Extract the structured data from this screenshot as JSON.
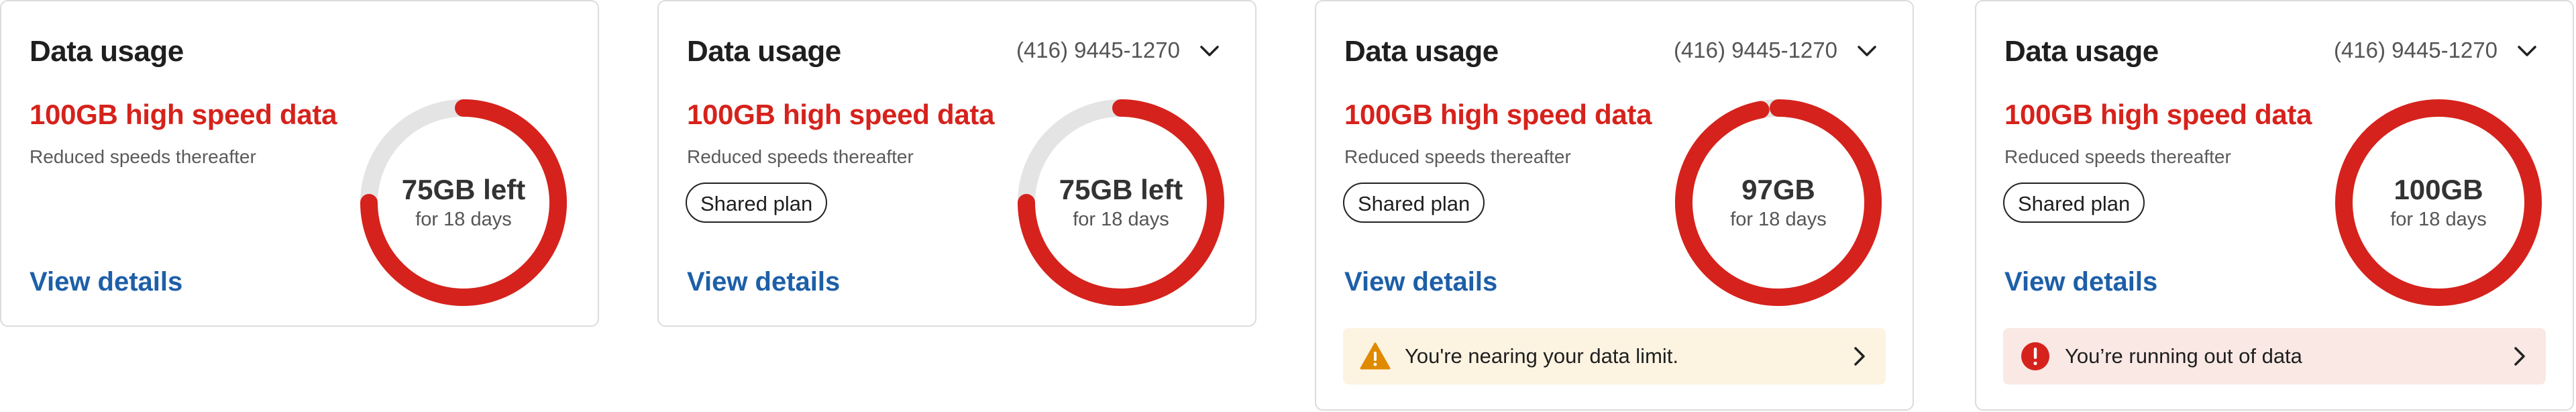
{
  "colors": {
    "accent_red": "#d6221c",
    "track_gray": "#e4e4e4",
    "link_blue": "#1d5fa8",
    "warning_bg": "#fdf3e1",
    "warning_icon": "#e08a00",
    "error_bg": "#f9e8e4",
    "error_icon": "#d6221c"
  },
  "cards": [
    {
      "title": "Data usage",
      "plan": "100GB high speed data",
      "subtitle": "Reduced speeds thereafter",
      "usage_main": "75GB left",
      "usage_sub": "for 18 days",
      "usage_fraction": 0.75,
      "link": "View details"
    },
    {
      "title": "Data usage",
      "phone": "(416) 9445-1270",
      "plan": "100GB high speed data",
      "subtitle": "Reduced speeds thereafter",
      "pill": "Shared plan",
      "usage_main": "75GB left",
      "usage_sub": "for 18 days",
      "usage_fraction": 0.75,
      "link": "View details"
    },
    {
      "title": "Data usage",
      "phone": "(416) 9445-1270",
      "plan": "100GB high speed data",
      "subtitle": "Reduced speeds thereafter",
      "pill": "Shared plan",
      "usage_main": "97GB",
      "usage_sub": "for 18 days",
      "usage_fraction": 0.97,
      "link": "View details",
      "alert": {
        "type": "warning",
        "icon": "warning-triangle-icon",
        "text": "You're nearing your data limit."
      }
    },
    {
      "title": "Data usage",
      "phone": "(416) 9445-1270",
      "plan": "100GB high speed data",
      "subtitle": "Reduced speeds thereafter",
      "pill": "Shared plan",
      "usage_main": "100GB",
      "usage_sub": "for 18 days",
      "usage_fraction": 1.0,
      "link": "View details",
      "alert": {
        "type": "error",
        "icon": "error-circle-icon",
        "text": "You’re running out of data"
      }
    }
  ]
}
